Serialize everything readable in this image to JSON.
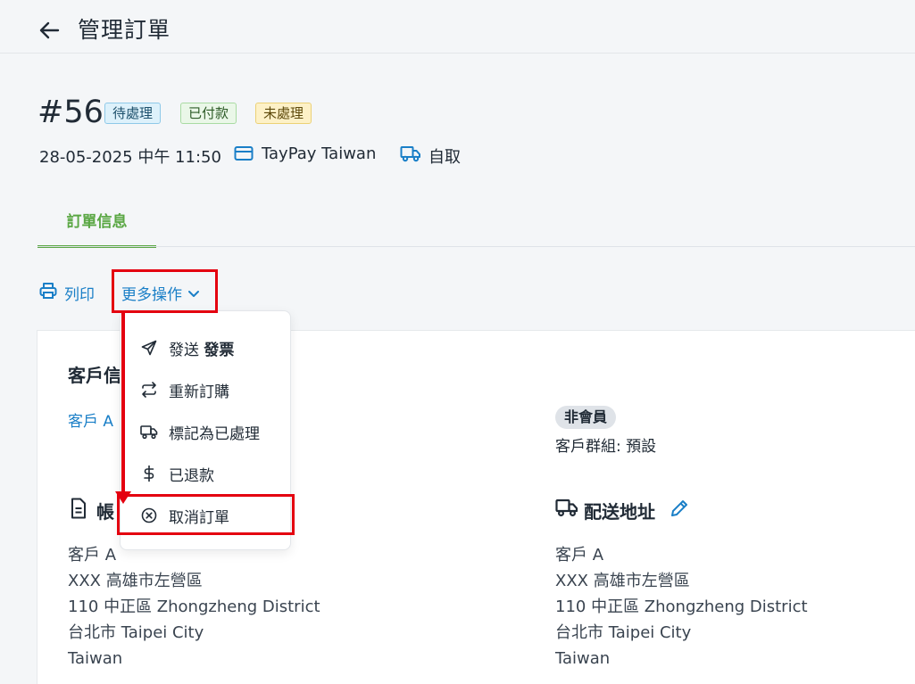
{
  "header": {
    "title": "管理訂單"
  },
  "order": {
    "number": "#56",
    "badges": {
      "status": "待處理",
      "payment": "已付款",
      "fulfillment": "未處理"
    },
    "date": "28-05-2025 中午 11:50",
    "payment_method": "TayPay Taiwan",
    "shipping_method": "自取"
  },
  "tabs": [
    {
      "label": "訂單信息",
      "active": true
    }
  ],
  "actions": {
    "print": "列印",
    "more": "更多操作"
  },
  "dropdown": {
    "items": [
      {
        "icon": "send-icon",
        "label": "發送 ",
        "label_bold": "發票"
      },
      {
        "icon": "repeat-icon",
        "label": "重新訂購"
      },
      {
        "icon": "truck-icon",
        "label": "標記為已處理"
      },
      {
        "icon": "dollar-icon",
        "label": "已退款"
      },
      {
        "icon": "cancel-circle-icon",
        "label": "取消訂單"
      }
    ]
  },
  "customer": {
    "title_visible": "客戶信",
    "name": "客戶 A",
    "membership": "非會員",
    "group": "客戶群組: 預設"
  },
  "billing": {
    "title_visible": "帳",
    "lines": [
      "客戶 A",
      "XXX 高雄市左營區",
      "110 中正區 Zhongzheng District",
      "台北市 Taipei City",
      "Taiwan"
    ]
  },
  "shipping": {
    "title": "配送地址",
    "lines": [
      "客戶 A",
      "XXX 高雄市左營區",
      "110 中正區 Zhongzheng District",
      "台北市 Taipei City",
      "Taiwan"
    ]
  },
  "colors": {
    "accent": "#1a7fc7",
    "tab_active": "#5aa744",
    "highlight": "#e4000f"
  }
}
